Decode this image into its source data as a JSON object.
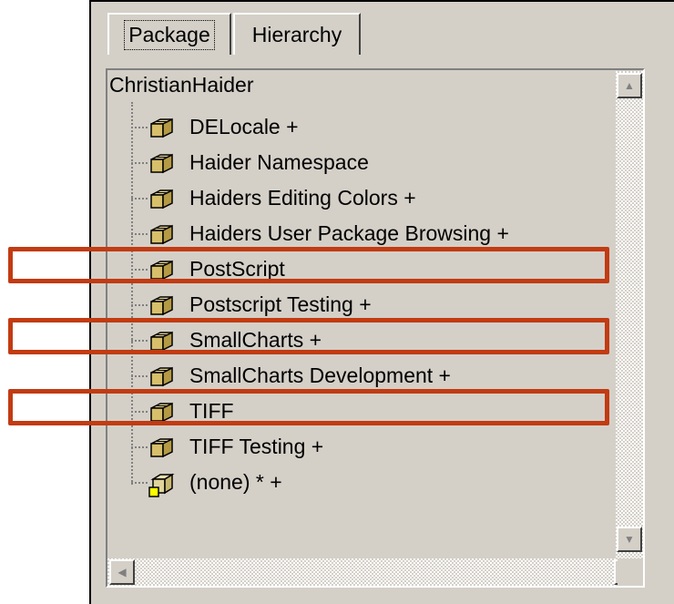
{
  "tabs": [
    {
      "label": "Package",
      "selected": true
    },
    {
      "label": "Hierarchy",
      "selected": false
    }
  ],
  "tree": {
    "root": "ChristianHaider",
    "items": [
      {
        "label": "DELocale +",
        "icon": "package-icon"
      },
      {
        "label": "Haider Namespace",
        "icon": "package-icon"
      },
      {
        "label": "Haiders Editing Colors +",
        "icon": "package-icon"
      },
      {
        "label": "Haiders User Package Browsing +",
        "icon": "package-icon"
      },
      {
        "label": "PostScript",
        "icon": "package-icon",
        "highlighted": true
      },
      {
        "label": "Postscript Testing +",
        "icon": "package-icon"
      },
      {
        "label": "SmallCharts +",
        "icon": "package-icon",
        "highlighted": true
      },
      {
        "label": "SmallCharts Development +",
        "icon": "package-icon"
      },
      {
        "label": "TIFF",
        "icon": "package-icon",
        "highlighted": true
      },
      {
        "label": "TIFF Testing +",
        "icon": "package-icon"
      },
      {
        "label": "(none) * +",
        "icon": "package-none-icon"
      }
    ]
  },
  "colors": {
    "highlight_box": "#c23b12",
    "window_bg": "#d4d0c8"
  }
}
